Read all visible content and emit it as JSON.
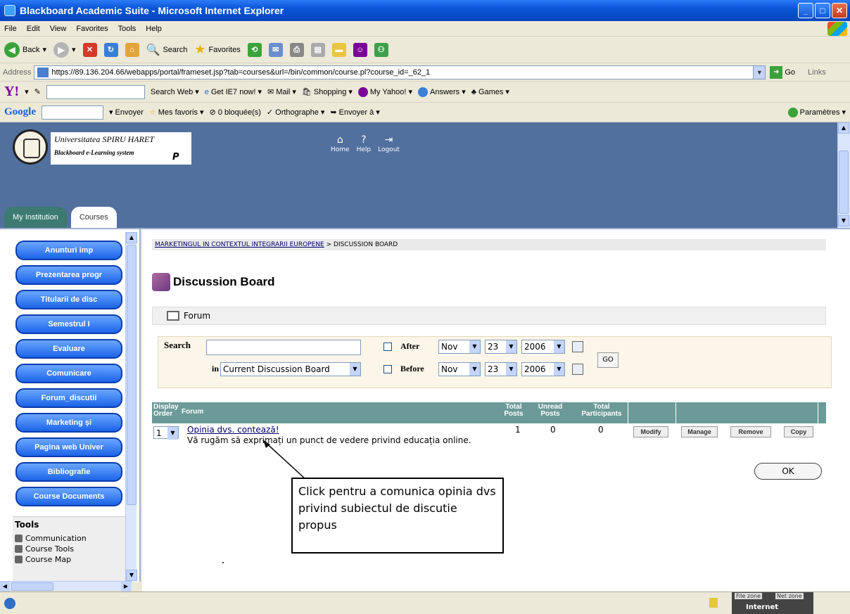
{
  "window": {
    "title": "Blackboard Academic Suite - Microsoft Internet Explorer"
  },
  "menu": [
    "File",
    "Edit",
    "View",
    "Favorites",
    "Tools",
    "Help"
  ],
  "toolbar": {
    "back": "Back",
    "search": "Search",
    "favorites": "Favorites"
  },
  "address": {
    "label": "Address",
    "url": "https://89.136.204.66/webapps/portal/frameset.jsp?tab=courses&url=/bin/common/course.pl?course_id=_62_1",
    "go": "Go",
    "links": "Links"
  },
  "yahoo": {
    "logo": "Y!",
    "items": [
      "Search Web",
      "Get IE7 now!",
      "Mail",
      "Shopping",
      "My Yahoo!",
      "Answers",
      "Games"
    ]
  },
  "google": {
    "logo": "Google",
    "items": [
      "Envoyer",
      "Mes favoris",
      "0 bloquée(s)",
      "Orthographe",
      "Envoyer à",
      "Paramètres"
    ]
  },
  "portal": {
    "logo_line1": "Universitatea SPIRU HARET",
    "logo_line2": "Blackboard e-Learning system",
    "logo_p": "P",
    "nav": [
      "Home",
      "Help",
      "Logout"
    ],
    "tabs": [
      "My Institution",
      "Courses"
    ]
  },
  "sidebar": {
    "buttons": [
      "Anunturi imp",
      "Prezentarea progr",
      "Titularii de disc",
      "Semestrul I",
      "Evaluare",
      "Comunicare",
      "Forum_discutii",
      "Marketing și",
      "Pagina web Univer",
      "Bibliografie",
      "Course Documents"
    ],
    "tools_title": "Tools",
    "tools": [
      "Communication",
      "Course Tools",
      "Course Map"
    ]
  },
  "main": {
    "breadcrumb_link": "MARKETINGUL IN CONTEXTUL INTEGRARII EUROPENE",
    "breadcrumb_current": " > DISCUSSION BOARD",
    "title": "Discussion Board",
    "forum_link": "Forum",
    "search": {
      "label": "Search",
      "in_label": "in",
      "scope": "Current Discussion Board",
      "after_label": "After",
      "before_label": "Before",
      "month": "Nov",
      "day": "23",
      "year": "2006",
      "go": "GO"
    },
    "table": {
      "headers": {
        "order": "Display Order",
        "forum": "Forum",
        "total_posts": "Total Posts",
        "unread_posts": "Unread Posts",
        "total_participants": "Total Participants"
      },
      "rows": [
        {
          "order": "1",
          "forum": "Opinia dvs. contează!",
          "description": "Vă rugăm să exprimați un punct de vedere privind educația online.",
          "total_posts": "1",
          "unread_posts": "0",
          "participants": "0",
          "actions": [
            "Modify",
            "Manage",
            "Remove",
            "Copy"
          ]
        }
      ]
    },
    "ok": "OK"
  },
  "callout": {
    "text": "Click pentru a comunica opinia dvs privind subiectul de discutie propus"
  },
  "status": {
    "zone1": "File zone",
    "zone2": "Net zone",
    "zone_text": "Internet"
  }
}
